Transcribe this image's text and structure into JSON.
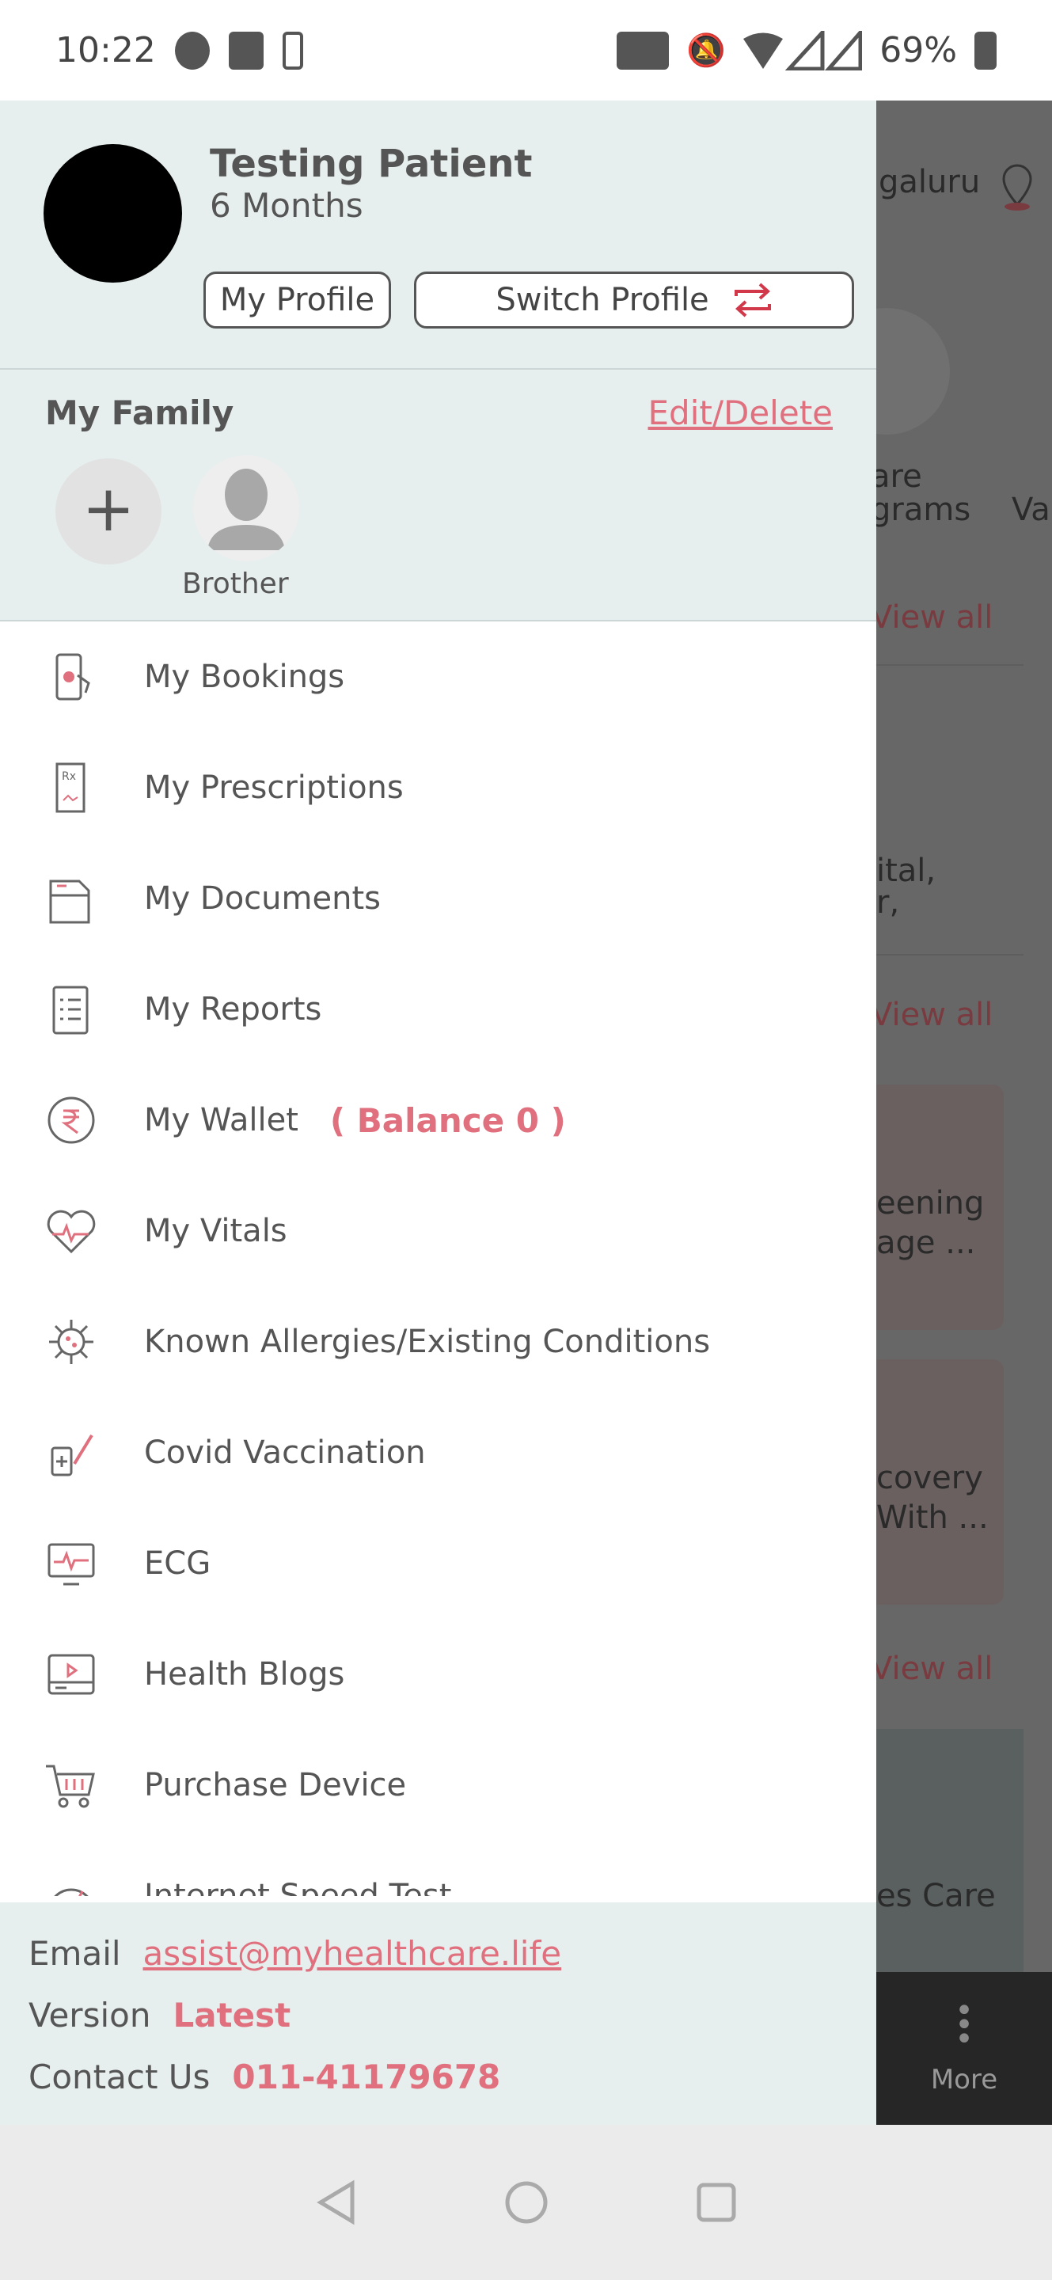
{
  "status_bar": {
    "time": "10:22",
    "battery": "69%"
  },
  "background": {
    "location": "galuru",
    "programs_l1": "are",
    "programs_l2": "grams",
    "va": "Va",
    "view_all_1": "View all",
    "text_1a": "ital,",
    "text_1b": "r,",
    "view_all_2": "View all",
    "card_1a": "eening",
    "card_1b": "age ...",
    "card_2a": "covery",
    "card_2b": "With ...",
    "view_all_3": "View all",
    "care": "es Care",
    "more": "More"
  },
  "profile": {
    "name": "Testing Patient",
    "age": "6 Months",
    "my_profile": "My Profile",
    "switch_profile": "Switch Profile"
  },
  "family": {
    "title": "My Family",
    "edit": "Edit/Delete",
    "members": [
      {
        "label": "Brother"
      }
    ]
  },
  "menu": [
    {
      "label": "My Bookings",
      "icon": "phone-booking-icon"
    },
    {
      "label": "My Prescriptions",
      "icon": "prescription-icon"
    },
    {
      "label": "My Documents",
      "icon": "folder-icon"
    },
    {
      "label": "My Reports",
      "icon": "clipboard-icon"
    },
    {
      "label": "My Wallet",
      "icon": "rupee-icon",
      "extra": "( Balance 0 )"
    },
    {
      "label": "My Vitals",
      "icon": "heart-pulse-icon"
    },
    {
      "label": "Known Allergies/Existing Conditions",
      "icon": "virus-icon"
    },
    {
      "label": "Covid Vaccination",
      "icon": "vaccine-icon"
    },
    {
      "label": "ECG",
      "icon": "ecg-monitor-icon"
    },
    {
      "label": "Health Blogs",
      "icon": "video-blog-icon"
    },
    {
      "label": "Purchase Device",
      "icon": "cart-icon"
    },
    {
      "label": "Internet Speed Test",
      "icon": "speedometer-icon"
    }
  ],
  "footer": {
    "email_label": "Email",
    "email": "assist@myhealthcare.life",
    "version_label": "Version",
    "version": "Latest",
    "contact_label": "Contact Us",
    "phone": "011-41179678"
  },
  "colors": {
    "accent": "#e0707e",
    "panel": "#e6eeee",
    "overlay": "#676767"
  }
}
